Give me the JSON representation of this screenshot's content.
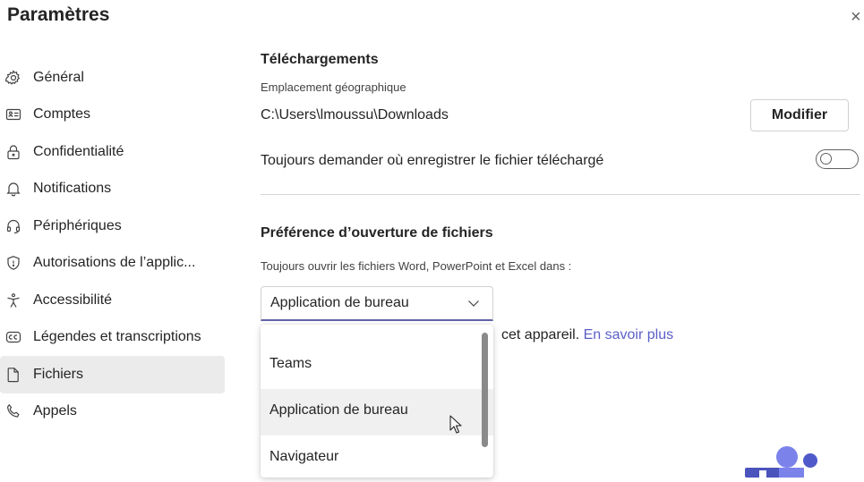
{
  "header": {
    "title": "Paramètres",
    "close_glyph": "×"
  },
  "sidebar": {
    "items": [
      {
        "label": "Général",
        "icon": "gear-icon"
      },
      {
        "label": "Comptes",
        "icon": "id-card-icon"
      },
      {
        "label": "Confidentialité",
        "icon": "lock-icon"
      },
      {
        "label": "Notifications",
        "icon": "bell-icon"
      },
      {
        "label": "Périphériques",
        "icon": "headset-icon"
      },
      {
        "label": "Autorisations de l’applic...",
        "icon": "shield-icon"
      },
      {
        "label": "Accessibilité",
        "icon": "accessibility-icon"
      },
      {
        "label": "Légendes et transcriptions",
        "icon": "captions-icon"
      },
      {
        "label": "Fichiers",
        "icon": "file-icon",
        "active": true
      },
      {
        "label": "Appels",
        "icon": "phone-icon"
      }
    ]
  },
  "downloads": {
    "title": "Téléchargements",
    "location_label": "Emplacement géographique",
    "path": "C:\\Users\\lmoussu\\Downloads",
    "modify_label": "Modifier",
    "always_ask_label": "Toujours demander où enregistrer le fichier téléchargé",
    "always_ask_on": false
  },
  "file_open": {
    "title": "Préférence d’ouverture de fichiers",
    "description": "Toujours ouvrir les fichiers Word, PowerPoint et Excel dans :",
    "selected": "Application de bureau",
    "partial_text": "cet appareil. ",
    "learn_more": "En savoir plus",
    "options": [
      "Teams",
      "Application de bureau",
      "Navigateur"
    ],
    "hovered_option": "Application de bureau"
  },
  "colors": {
    "accent": "#6264a7",
    "link": "#5b5fc7",
    "active_bg": "#ebebeb"
  }
}
